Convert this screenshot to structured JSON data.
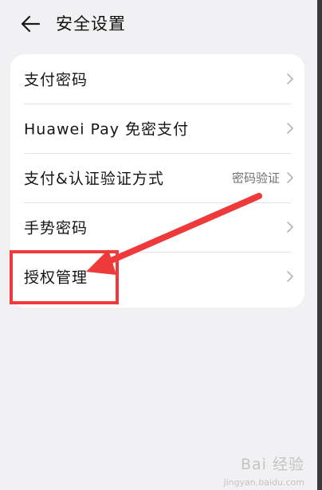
{
  "header": {
    "title": "安全设置",
    "back_icon": "arrow-left-icon"
  },
  "settings": [
    {
      "label": "支付密码",
      "value": ""
    },
    {
      "label": "Huawei Pay 免密支付",
      "value": ""
    },
    {
      "label": "支付&认证验证方式",
      "value": "密码验证"
    },
    {
      "label": "手势密码",
      "value": ""
    },
    {
      "label": "授权管理",
      "value": ""
    }
  ],
  "annotation": {
    "color": "#ee3a3a",
    "highlighted_item": "授权管理"
  },
  "watermark": {
    "text": "Bai 经验",
    "sub": "jingyan.baidu.com"
  }
}
